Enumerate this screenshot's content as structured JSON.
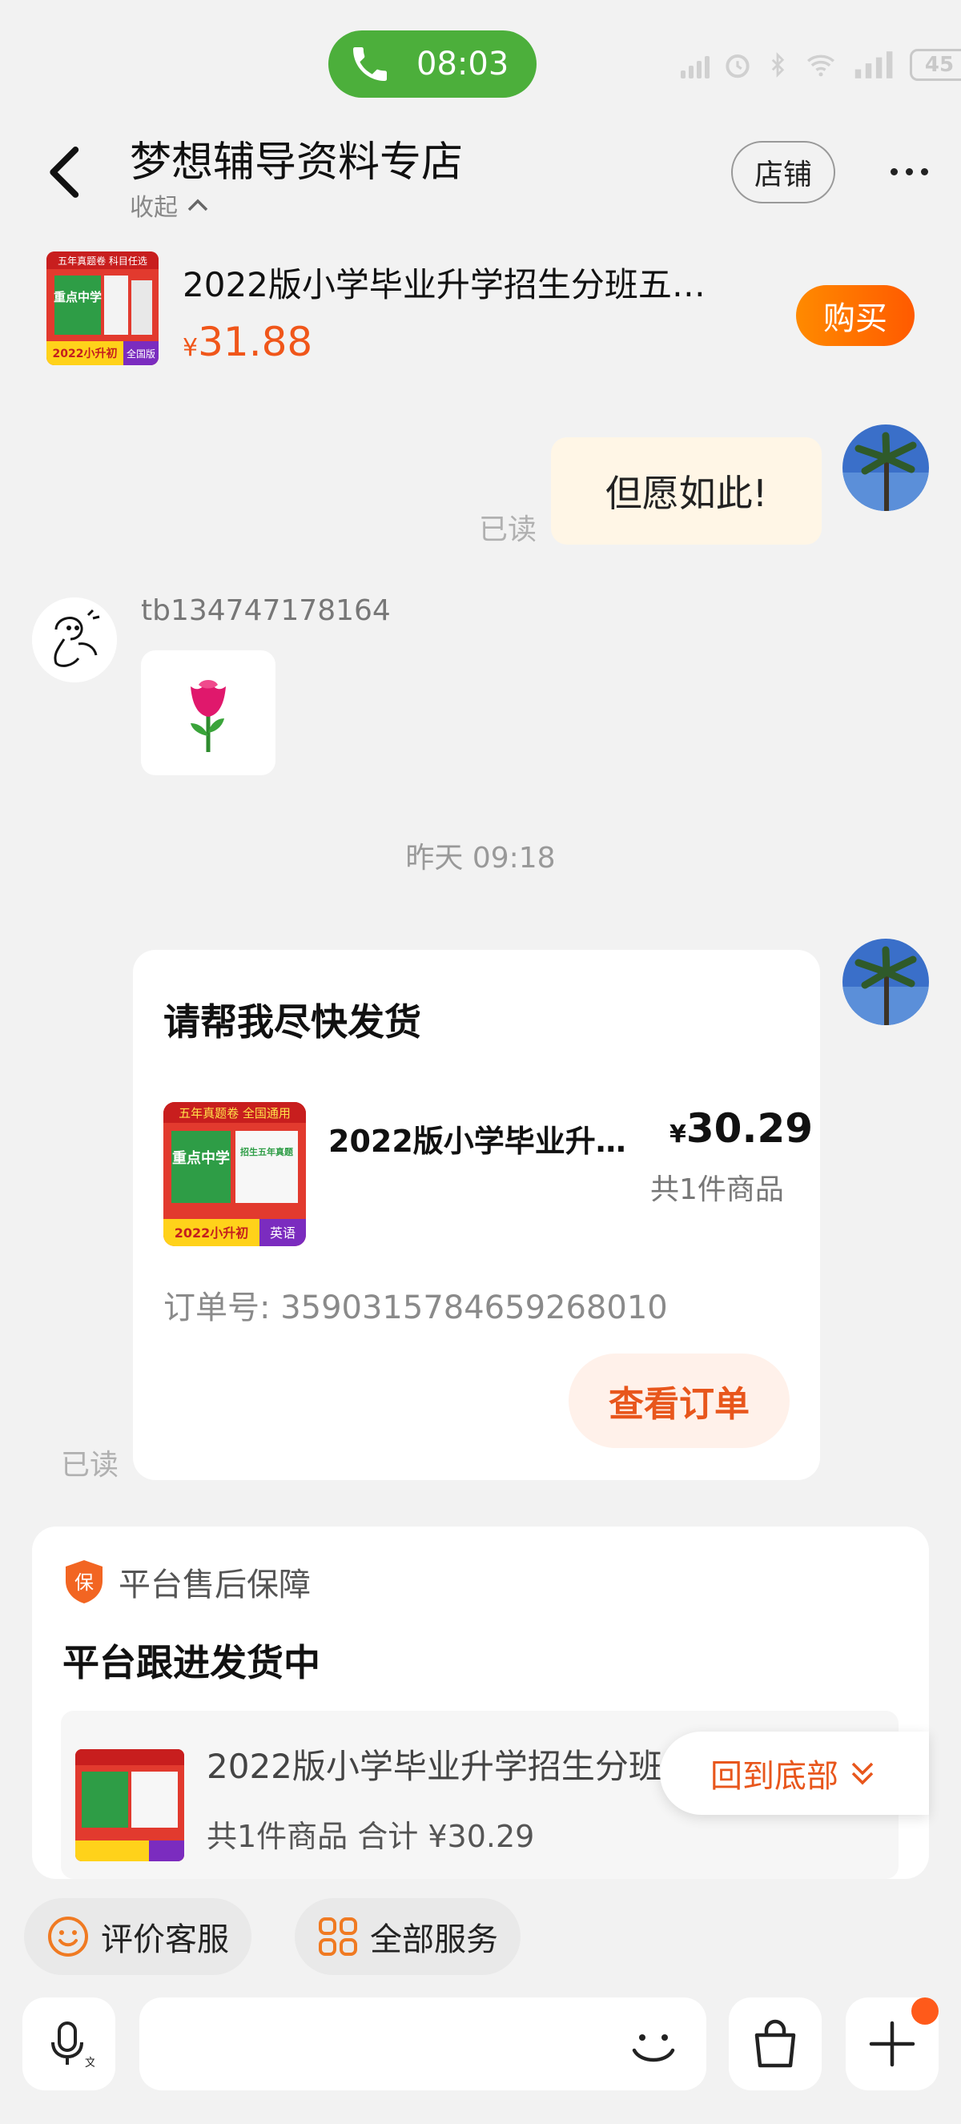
{
  "status_bar": {
    "call_time": "08:03",
    "battery": "45"
  },
  "header": {
    "title": "梦想辅导资料专店",
    "collapse_label": "收起",
    "shop_button": "店铺"
  },
  "product_bar": {
    "name": "2022版小学毕业升学招生分班五…",
    "price_symbol": "¥",
    "price": "31.88",
    "buy_button": "购买",
    "thumb": {
      "top_banner": "五年真题卷 科目任选",
      "big_text": "重点中学",
      "bottom_label": "2022小升初",
      "edition": "全国版"
    }
  },
  "messages": {
    "my_reply": "但愿如此!",
    "read_label_1": "已读",
    "other_sender": "tb134747178164",
    "timestamp": "昨天  09:18"
  },
  "order_card": {
    "title": "请帮我尽快发货",
    "product_name": "2022版小学毕业升…",
    "price_symbol": "¥",
    "price": "30.29",
    "count": "共1件商品",
    "order_number": "订单号:  3590315784659268010",
    "view_button": "查看订单",
    "read_label": "已读",
    "thumb": {
      "top_banner": "五年真题卷 全国通用",
      "big_text": "重点中学",
      "sub_text": "招生五年真题",
      "bottom_label": "2022小升初",
      "subject": "英语"
    }
  },
  "guarantee_card": {
    "header": "平台售后保障",
    "badge": "保",
    "title": "平台跟进发货中",
    "product_name": "2022版小学毕业升学招生分班五年真题",
    "total": "共1件商品  合计 ¥30.29",
    "back_to_bottom": "回到底部"
  },
  "quick_actions": {
    "rate_service": "评价客服",
    "all_services": "全部服务"
  },
  "colors": {
    "accent": "#f0561a",
    "call_green": "#4caf3b",
    "bubble_self": "#fff6e6"
  }
}
